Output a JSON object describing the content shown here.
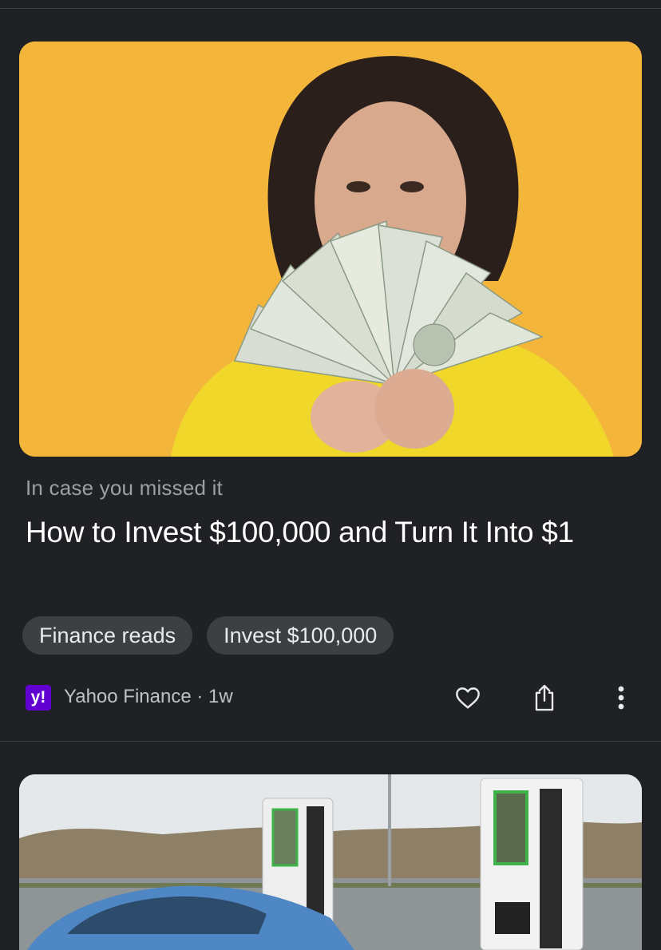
{
  "article1": {
    "kicker": "In case you missed it",
    "headline": "How to Invest $100,000 and Turn It Into $1",
    "chips": [
      "Finance reads",
      "Invest $100,000"
    ],
    "source_logo": "y!",
    "source": "Yahoo Finance",
    "separator": "·",
    "age": "1w",
    "icons": [
      "heart-icon",
      "share-icon",
      "more-vert-icon"
    ],
    "image_description": "woman-holding-dollar-bills"
  },
  "article2": {
    "image_description": "ev-charging-stations-with-blue-car"
  },
  "colors": {
    "background": "#202124",
    "chip": "#3c4043",
    "yahoo_purple": "#6001d2",
    "image_bg": "#f3b33a"
  }
}
